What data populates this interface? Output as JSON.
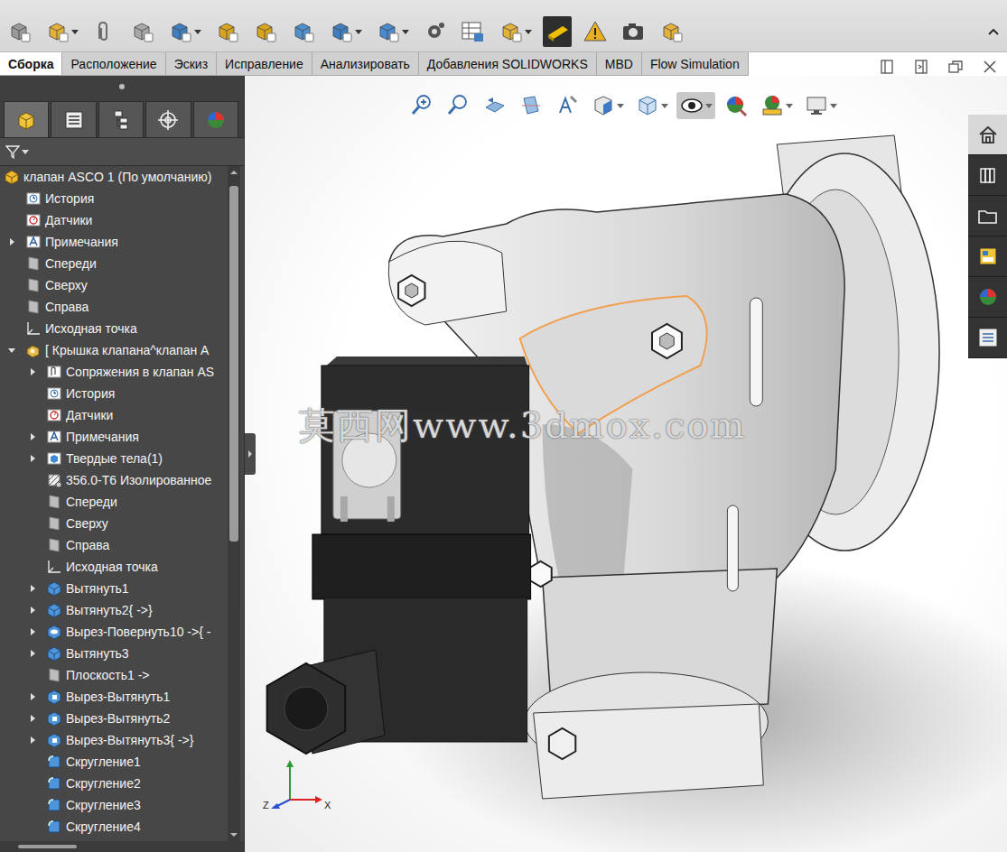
{
  "main_toolbar": [
    {
      "kind": "component-gray",
      "dropdown": false,
      "selected": false
    },
    {
      "kind": "insert-component",
      "dropdown": true,
      "selected": false
    },
    {
      "kind": "mate",
      "dropdown": false,
      "selected": false
    },
    {
      "kind": "component-preview",
      "dropdown": false,
      "selected": false
    },
    {
      "kind": "linear-pattern",
      "dropdown": true,
      "selected": false
    },
    {
      "kind": "smart-fasteners",
      "dropdown": false,
      "selected": false
    },
    {
      "kind": "move-component",
      "dropdown": false,
      "selected": false
    },
    {
      "kind": "show-hidden",
      "dropdown": false,
      "selected": false
    },
    {
      "kind": "assembly-features",
      "dropdown": true,
      "selected": false
    },
    {
      "kind": "reference-geometry",
      "dropdown": true,
      "selected": false
    },
    {
      "kind": "motion-study",
      "dropdown": false,
      "selected": false
    },
    {
      "kind": "bom",
      "dropdown": false,
      "selected": false
    },
    {
      "kind": "exploded-view",
      "dropdown": true,
      "selected": false
    },
    {
      "kind": "instant3d",
      "dropdown": false,
      "selected": true
    },
    {
      "kind": "interference",
      "dropdown": false,
      "selected": false
    },
    {
      "kind": "snapshot",
      "dropdown": false,
      "selected": false
    },
    {
      "kind": "large-assembly",
      "dropdown": false,
      "selected": false
    }
  ],
  "ribbon_tabs": [
    {
      "label": "Сборка",
      "selected": true
    },
    {
      "label": "Расположение",
      "selected": false
    },
    {
      "label": "Эскиз",
      "selected": false
    },
    {
      "label": "Исправление",
      "selected": false
    },
    {
      "label": "Анализировать",
      "selected": false
    },
    {
      "label": "Добавления SOLIDWORKS",
      "selected": false
    },
    {
      "label": "MBD",
      "selected": false
    },
    {
      "label": "Flow Simulation",
      "selected": false
    }
  ],
  "window_controls": [
    {
      "kind": "dock-left"
    },
    {
      "kind": "dock-right"
    },
    {
      "kind": "restore"
    },
    {
      "kind": "close"
    }
  ],
  "panel_tabs": [
    {
      "kind": "features",
      "selected": true
    },
    {
      "kind": "properties",
      "selected": false
    },
    {
      "kind": "configurations",
      "selected": false
    },
    {
      "kind": "dimxpert",
      "selected": false
    },
    {
      "kind": "display",
      "selected": false
    }
  ],
  "tree": {
    "items": [
      {
        "label": "клапан ASCO 1 (По умолчанию)",
        "depth": 0,
        "kind": "assembly",
        "expandable": false,
        "expanded": false
      },
      {
        "label": "История",
        "depth": 1,
        "kind": "history",
        "expandable": false,
        "expanded": false
      },
      {
        "label": "Датчики",
        "depth": 1,
        "kind": "sensor",
        "expandable": false,
        "expanded": false
      },
      {
        "label": "Примечания",
        "depth": 1,
        "kind": "annotation",
        "expandable": true,
        "expanded": false
      },
      {
        "label": "Спереди",
        "depth": 1,
        "kind": "plane",
        "expandable": false,
        "expanded": false
      },
      {
        "label": "Сверху",
        "depth": 1,
        "kind": "plane",
        "expandable": false,
        "expanded": false
      },
      {
        "label": "Справа",
        "depth": 1,
        "kind": "plane",
        "expandable": false,
        "expanded": false
      },
      {
        "label": "Исходная точка",
        "depth": 1,
        "kind": "origin",
        "expandable": false,
        "expanded": false
      },
      {
        "label": "[ Крышка клапана^клапан А",
        "depth": 1,
        "kind": "part",
        "expandable": true,
        "expanded": true
      },
      {
        "label": "Сопряжения в клапан AS",
        "depth": 2,
        "kind": "mates",
        "expandable": true,
        "expanded": false
      },
      {
        "label": "История",
        "depth": 2,
        "kind": "history",
        "expandable": false,
        "expanded": false
      },
      {
        "label": "Датчики",
        "depth": 2,
        "kind": "sensor",
        "expandable": false,
        "expanded": false
      },
      {
        "label": "Примечания",
        "depth": 2,
        "kind": "annotation",
        "expandable": true,
        "expanded": false
      },
      {
        "label": "Твердые тела(1)",
        "depth": 2,
        "kind": "bodies",
        "expandable": true,
        "expanded": false
      },
      {
        "label": "356.0-T6 Изолированное",
        "depth": 2,
        "kind": "material",
        "expandable": false,
        "expanded": false
      },
      {
        "label": "Спереди",
        "depth": 2,
        "kind": "plane",
        "expandable": false,
        "expanded": false
      },
      {
        "label": "Сверху",
        "depth": 2,
        "kind": "plane",
        "expandable": false,
        "expanded": false
      },
      {
        "label": "Справа",
        "depth": 2,
        "kind": "plane",
        "expandable": false,
        "expanded": false
      },
      {
        "label": "Исходная точка",
        "depth": 2,
        "kind": "origin",
        "expandable": false,
        "expanded": false
      },
      {
        "label": "Вытянуть1",
        "depth": 2,
        "kind": "extrude",
        "expandable": true,
        "expanded": false
      },
      {
        "label": "Вытянуть2{ ->}",
        "depth": 2,
        "kind": "extrude",
        "expandable": true,
        "expanded": false
      },
      {
        "label": "Вырез-Повернуть10 ->{ -",
        "depth": 2,
        "kind": "revolve-cut",
        "expandable": true,
        "expanded": false
      },
      {
        "label": "Вытянуть3",
        "depth": 2,
        "kind": "extrude",
        "expandable": true,
        "expanded": false
      },
      {
        "label": "Плоскость1 ->",
        "depth": 2,
        "kind": "plane",
        "expandable": false,
        "expanded": false
      },
      {
        "label": "Вырез-Вытянуть1",
        "depth": 2,
        "kind": "cut",
        "expandable": true,
        "expanded": false
      },
      {
        "label": "Вырез-Вытянуть2",
        "depth": 2,
        "kind": "cut",
        "expandable": true,
        "expanded": false
      },
      {
        "label": "Вырез-Вытянуть3{ ->}",
        "depth": 2,
        "kind": "cut",
        "expandable": true,
        "expanded": false
      },
      {
        "label": "Скругление1",
        "depth": 2,
        "kind": "fillet",
        "expandable": false,
        "expanded": false
      },
      {
        "label": "Скругление2",
        "depth": 2,
        "kind": "fillet",
        "expandable": false,
        "expanded": false
      },
      {
        "label": "Скругление3",
        "depth": 2,
        "kind": "fillet",
        "expandable": false,
        "expanded": false
      },
      {
        "label": "Скругление4",
        "depth": 2,
        "kind": "fillet",
        "expandable": false,
        "expanded": false
      }
    ],
    "scrollbar": {
      "level": 0.55
    },
    "h_scrollbar": {
      "level": 0.26
    }
  },
  "view_toolbar": [
    {
      "kind": "zoom-fit",
      "dropdown": false,
      "selected": false
    },
    {
      "kind": "zoom-area",
      "dropdown": false,
      "selected": false
    },
    {
      "kind": "previous-view",
      "dropdown": false,
      "selected": false
    },
    {
      "kind": "section-view",
      "dropdown": false,
      "selected": false
    },
    {
      "kind": "dynamic-annotation",
      "dropdown": false,
      "selected": false
    },
    {
      "kind": "view-orientation",
      "dropdown": true,
      "selected": false
    },
    {
      "kind": "display-style",
      "dropdown": true,
      "selected": false
    },
    {
      "kind": "hide-show",
      "dropdown": true,
      "selected": true
    },
    {
      "kind": "edit-appearance",
      "dropdown": false,
      "selected": false
    },
    {
      "kind": "apply-scene",
      "dropdown": true,
      "selected": false
    },
    {
      "kind": "view-settings",
      "dropdown": true,
      "selected": false
    }
  ],
  "task_pane": [
    {
      "kind": "home",
      "selected": true
    },
    {
      "kind": "library",
      "selected": false
    },
    {
      "kind": "explorer",
      "selected": false
    },
    {
      "kind": "palette",
      "selected": false
    },
    {
      "kind": "appearances",
      "selected": false
    },
    {
      "kind": "custom-properties",
      "selected": false
    }
  ],
  "viewport": {
    "watermark": "莫西网www.3dmox.com",
    "triad": {
      "labels": [
        "Z",
        "X"
      ]
    }
  }
}
